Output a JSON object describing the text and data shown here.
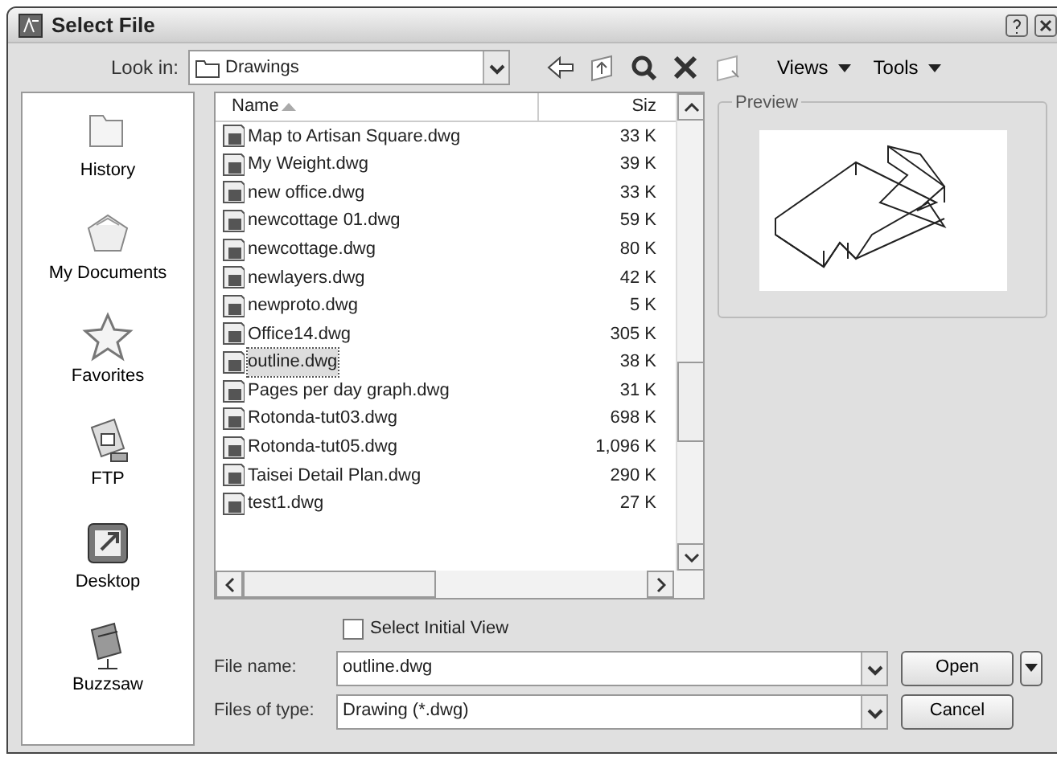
{
  "window": {
    "title": "Select File"
  },
  "toolbar": {
    "look_in_label": "Look in:",
    "look_in_value": "Drawings",
    "views": "Views",
    "tools": "Tools"
  },
  "places": [
    {
      "label": "History",
      "kind": "history"
    },
    {
      "label": "My Documents",
      "kind": "documents"
    },
    {
      "label": "Favorites",
      "kind": "favorites"
    },
    {
      "label": "FTP",
      "kind": "ftp"
    },
    {
      "label": "Desktop",
      "kind": "desktop"
    },
    {
      "label": "Buzzsaw",
      "kind": "buzzsaw"
    }
  ],
  "file_list": {
    "columns": [
      "Name",
      "Siz"
    ],
    "rows": [
      {
        "name": "Map to Artisan Square.dwg",
        "size": "33 K",
        "selected": false
      },
      {
        "name": "My Weight.dwg",
        "size": "39 K",
        "selected": false
      },
      {
        "name": "new office.dwg",
        "size": "33 K",
        "selected": false
      },
      {
        "name": "newcottage 01.dwg",
        "size": "59 K",
        "selected": false
      },
      {
        "name": "newcottage.dwg",
        "size": "80 K",
        "selected": false
      },
      {
        "name": "newlayers.dwg",
        "size": "42 K",
        "selected": false
      },
      {
        "name": "newproto.dwg",
        "size": "5 K",
        "selected": false
      },
      {
        "name": "Office14.dwg",
        "size": "305 K",
        "selected": false
      },
      {
        "name": "outline.dwg",
        "size": "38 K",
        "selected": true
      },
      {
        "name": "Pages per day graph.dwg",
        "size": "31 K",
        "selected": false
      },
      {
        "name": "Rotonda-tut03.dwg",
        "size": "698 K",
        "selected": false
      },
      {
        "name": "Rotonda-tut05.dwg",
        "size": "1,096 K",
        "selected": false
      },
      {
        "name": "Taisei Detail Plan.dwg",
        "size": "290 K",
        "selected": false
      },
      {
        "name": "test1.dwg",
        "size": "27 K",
        "selected": false
      }
    ]
  },
  "preview": {
    "title": "Preview"
  },
  "select_initial_view": {
    "label": "Select Initial View",
    "checked": false
  },
  "file_name": {
    "label": "File name:",
    "value": "outline.dwg"
  },
  "files_of_type": {
    "label": "Files of type:",
    "value": "Drawing (*.dwg)"
  },
  "buttons": {
    "open": "Open",
    "cancel": "Cancel"
  }
}
